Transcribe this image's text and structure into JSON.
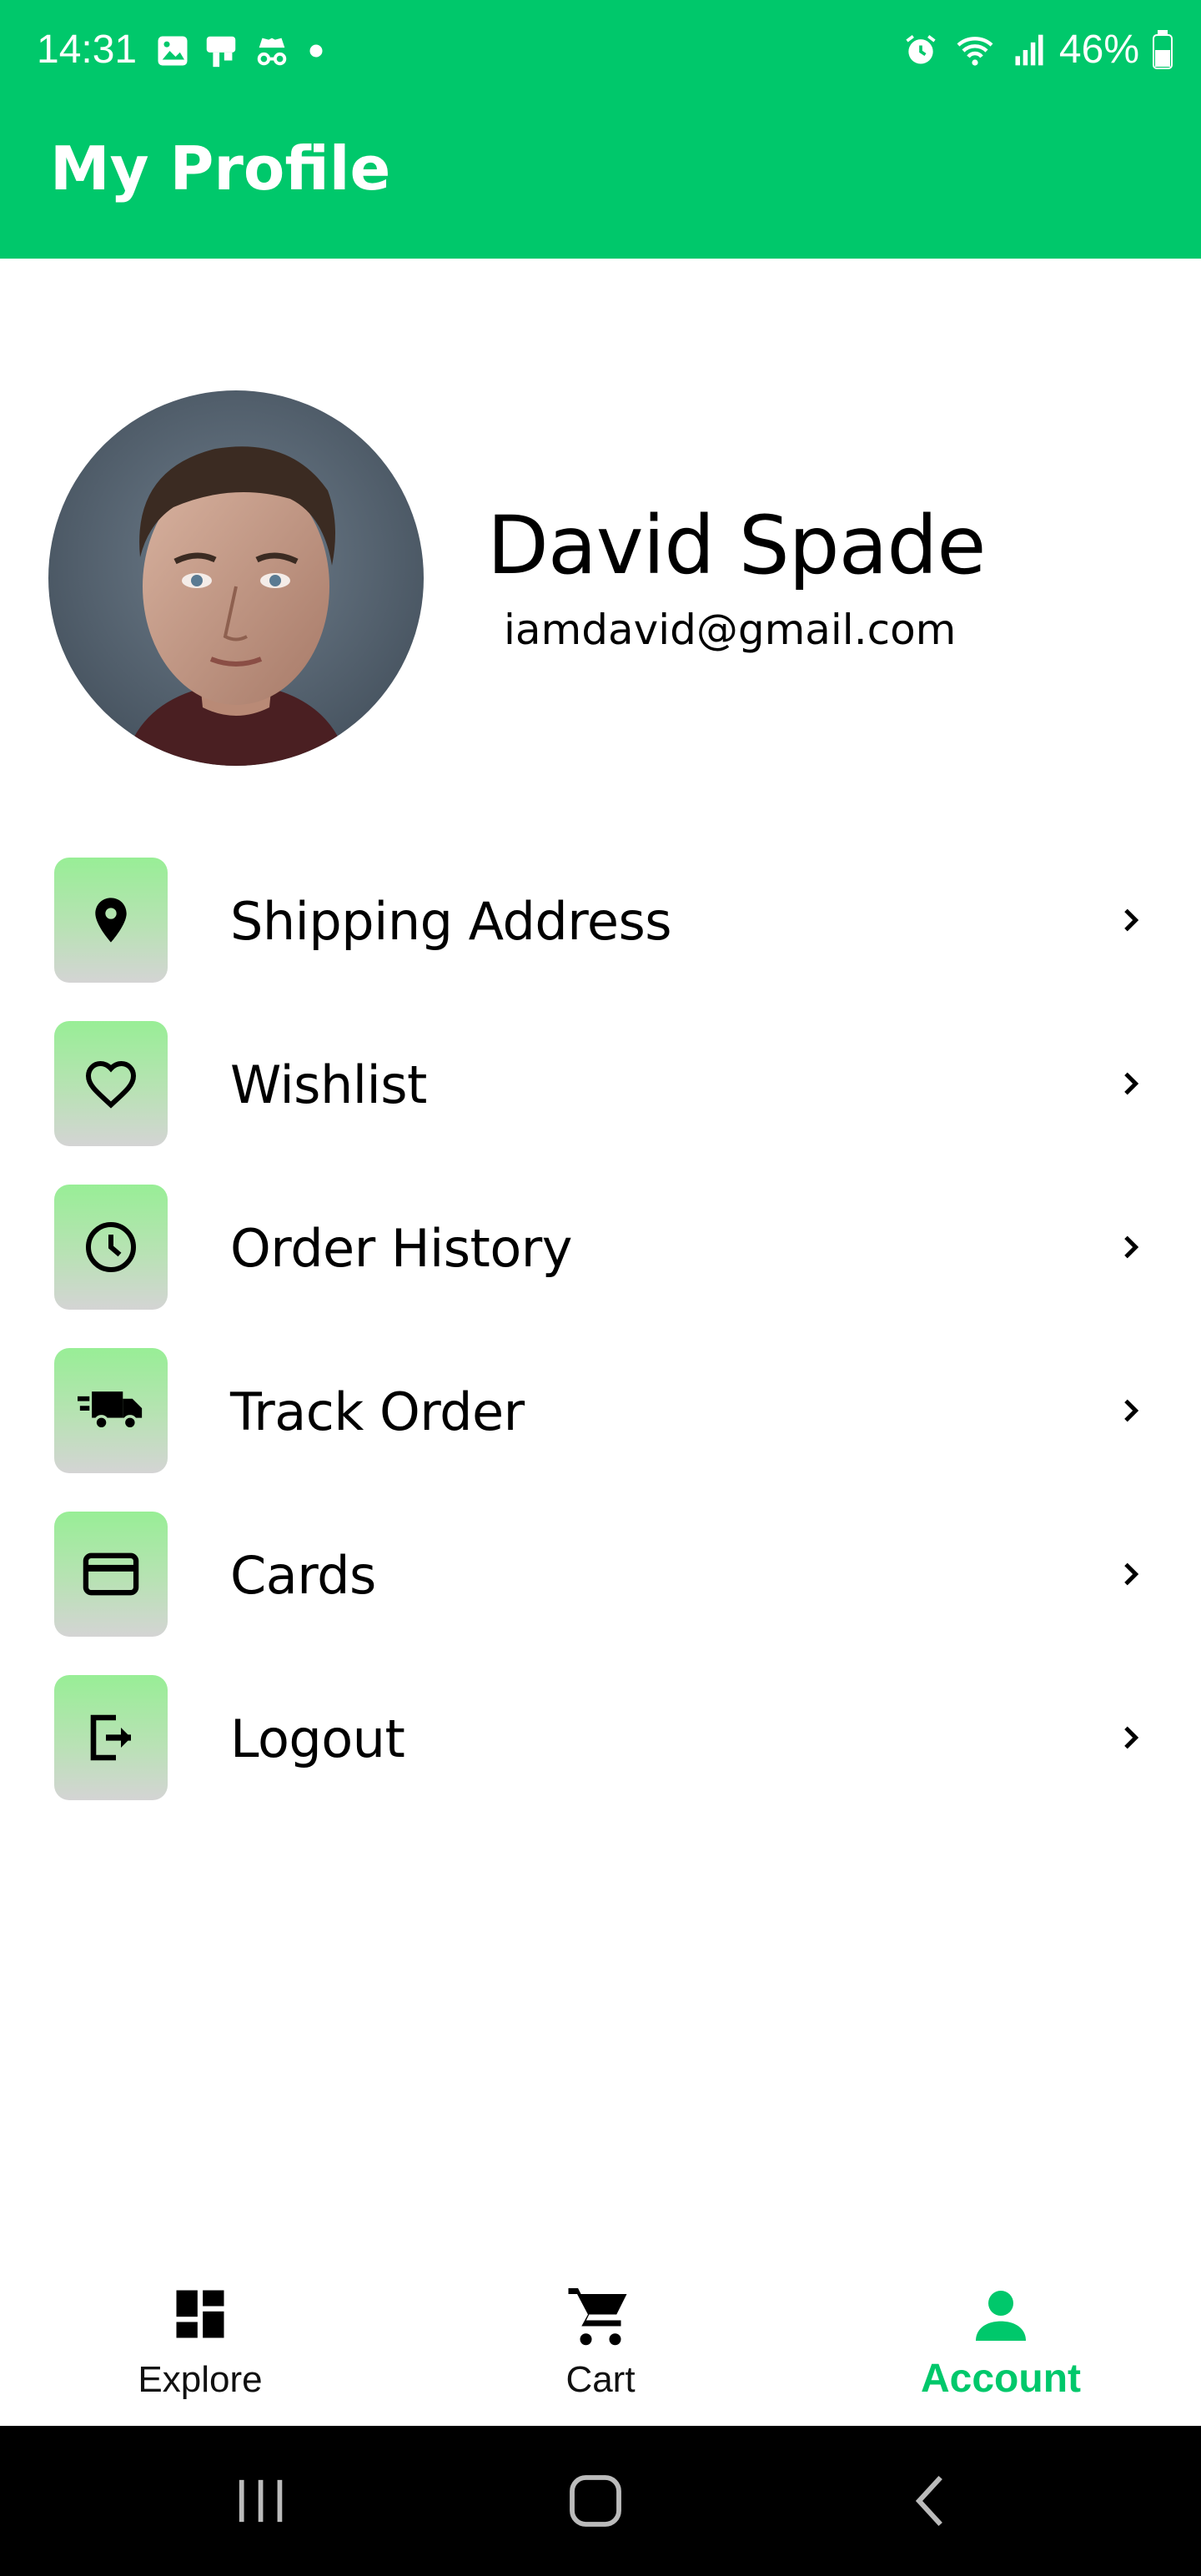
{
  "status_bar": {
    "time": "14:31",
    "battery": "46%"
  },
  "header": {
    "title": "My Profile"
  },
  "profile": {
    "name": "David Spade",
    "email": "iamdavid@gmail.com"
  },
  "menu": {
    "items": [
      {
        "label": "Shipping Address",
        "icon": "location-pin-icon"
      },
      {
        "label": "Wishlist",
        "icon": "heart-icon"
      },
      {
        "label": "Order History",
        "icon": "clock-icon"
      },
      {
        "label": "Track Order",
        "icon": "delivery-truck-icon"
      },
      {
        "label": "Cards",
        "icon": "credit-card-icon"
      },
      {
        "label": "Logout",
        "icon": "logout-icon"
      }
    ]
  },
  "bottom_nav": {
    "items": [
      {
        "label": "Explore",
        "icon": "dashboard-icon",
        "active": false
      },
      {
        "label": "Cart",
        "icon": "cart-icon",
        "active": false
      },
      {
        "label": "Account",
        "icon": "person-icon",
        "active": true
      }
    ]
  },
  "colors": {
    "brand": "#00c86b",
    "icon_box_top": "#98ee96",
    "icon_box_bottom": "#d4d4d4"
  }
}
